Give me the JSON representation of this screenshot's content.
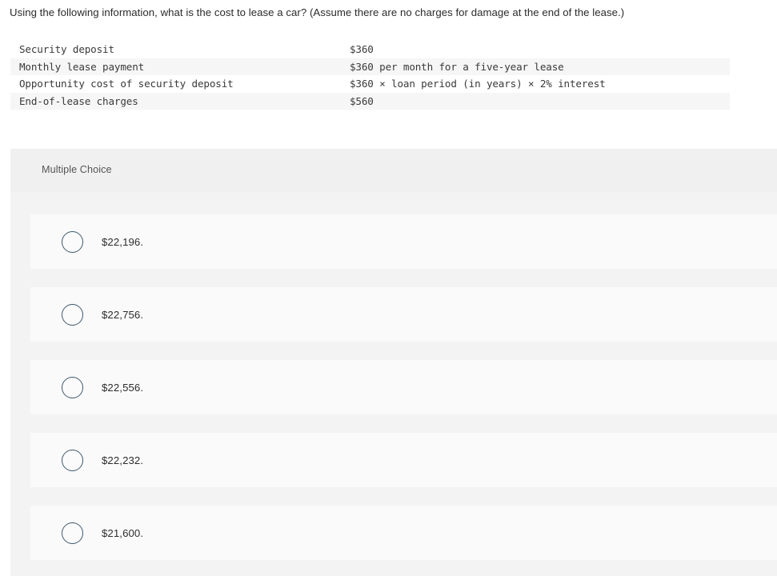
{
  "question": {
    "stem": "Using the following information, what is the cost to lease a car? (Assume there are no charges for damage at the end of the lease.)"
  },
  "info_table": {
    "rows": [
      {
        "label": "Security deposit",
        "value": "$360"
      },
      {
        "label": "Monthly lease payment",
        "value": "$360 per month for a five-year lease"
      },
      {
        "label": "Opportunity cost of security deposit",
        "value": "$360 × loan period (in years) × 2% interest"
      },
      {
        "label": "End-of-lease charges",
        "value": "$560"
      }
    ]
  },
  "answer_panel": {
    "type_label": "Multiple Choice",
    "choices": [
      {
        "label": "$22,196.",
        "selected": false
      },
      {
        "label": "$22,756.",
        "selected": false
      },
      {
        "label": "$22,556.",
        "selected": false
      },
      {
        "label": "$22,232.",
        "selected": false
      },
      {
        "label": "$21,600.",
        "selected": false
      }
    ]
  },
  "colors": {
    "page_background": "#ffffff",
    "table_stripe": "#f6f6f6",
    "panel_header": "#f0f0f0",
    "panel_body": "#f3f3f3",
    "choice_card": "#fafafa",
    "radio_border": "#3e5a6b",
    "text_primary": "#2b2b2b",
    "text_muted": "#555555"
  }
}
